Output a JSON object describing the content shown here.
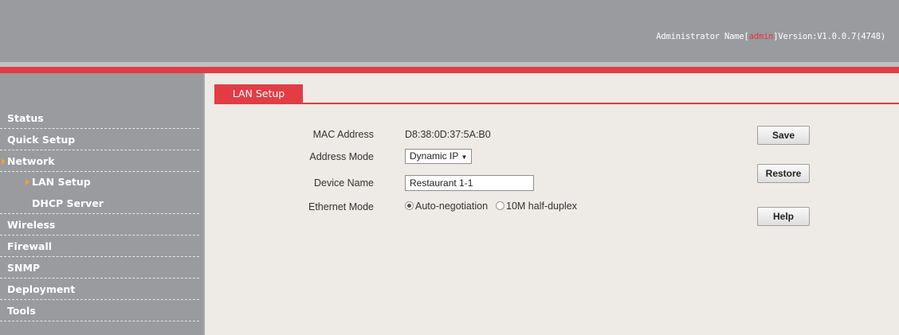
{
  "header": {
    "admin_prefix": "Administrator Name[",
    "admin_name": "admin",
    "version_text": "]Version:V1.0.0.7(4748)",
    "accent_color": "#e33c44"
  },
  "sidebar": {
    "items": [
      {
        "label": "Status"
      },
      {
        "label": "Quick Setup"
      },
      {
        "label": "Network",
        "expanded": true,
        "icon": "triangle-right-icon"
      },
      {
        "label": "LAN Setup",
        "selected": true,
        "icon": "triangle-right-icon"
      },
      {
        "label": "DHCP Server"
      },
      {
        "label": "Wireless"
      },
      {
        "label": "Firewall"
      },
      {
        "label": "SNMP"
      },
      {
        "label": "Deployment"
      },
      {
        "label": "Tools"
      }
    ]
  },
  "main": {
    "tab_label": "LAN Setup",
    "form": {
      "mac_label": "MAC Address",
      "mac_value": "D8:38:0D:37:5A:B0",
      "address_mode_label": "Address Mode",
      "address_mode_value": "Dynamic IP",
      "device_name_label": "Device Name",
      "device_name_value": "Restaurant 1-1",
      "ethernet_mode_label": "Ethernet Mode",
      "ethernet_options": [
        {
          "label": "Auto-negotiation",
          "checked": true
        },
        {
          "label": "10M half-duplex",
          "checked": false
        }
      ]
    },
    "buttons": {
      "save": "Save",
      "restore": "Restore",
      "help": "Help"
    }
  }
}
